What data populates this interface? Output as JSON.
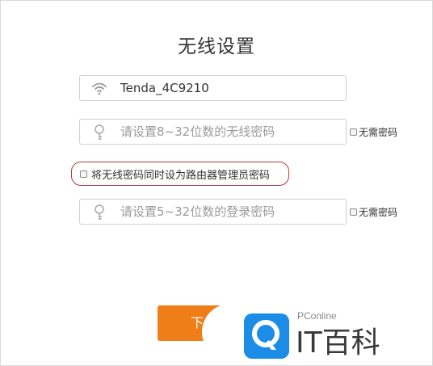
{
  "title": "无线设置",
  "ssid_field": {
    "value": "Tenda_4C9210",
    "icon": "wifi-icon"
  },
  "wifi_password_field": {
    "placeholder": "请设置8~32位数的无线密码",
    "icon": "key-icon"
  },
  "wifi_no_password": {
    "label": "无需密码",
    "checked": false
  },
  "sync_option": {
    "label": "将无线密码同时设为路由器管理员密码",
    "checked": false
  },
  "login_password_field": {
    "placeholder": "请设置5~32位数的登录密码",
    "icon": "key-icon"
  },
  "login_no_password": {
    "label": "无需密码",
    "checked": false
  },
  "next_button": {
    "label": "下"
  },
  "watermark": {
    "brand": "PConline",
    "name": "IT百科"
  },
  "colors": {
    "accent": "#ef7e19",
    "highlight_border": "#b53a3a",
    "watermark_blue": "#1b8de6"
  }
}
